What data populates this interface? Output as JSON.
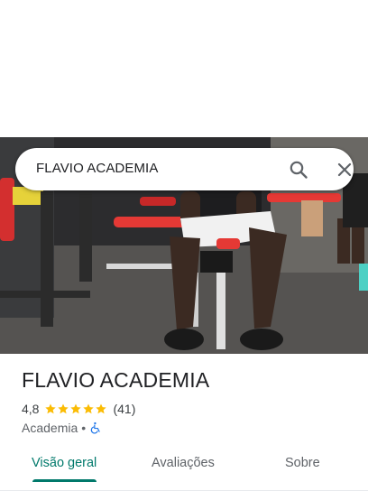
{
  "search": {
    "query": "FLAVIO ACADEMIA"
  },
  "icons": {
    "search": "search-icon",
    "close": "close-icon",
    "star": "star-icon",
    "accessibility": "wheelchair-accessible-icon"
  },
  "place": {
    "name": "FLAVIO ACADEMIA",
    "rating": "4,8",
    "stars_filled": 5,
    "review_count": "(41)",
    "category": "Academia",
    "separator": "•"
  },
  "tabs": [
    {
      "label": "Visão geral",
      "active": true
    },
    {
      "label": "Avaliações",
      "active": false
    },
    {
      "label": "Sobre",
      "active": false
    }
  ],
  "colors": {
    "accent": "#00796b",
    "star": "#fbbc04",
    "accessibility": "#1a73e8"
  }
}
